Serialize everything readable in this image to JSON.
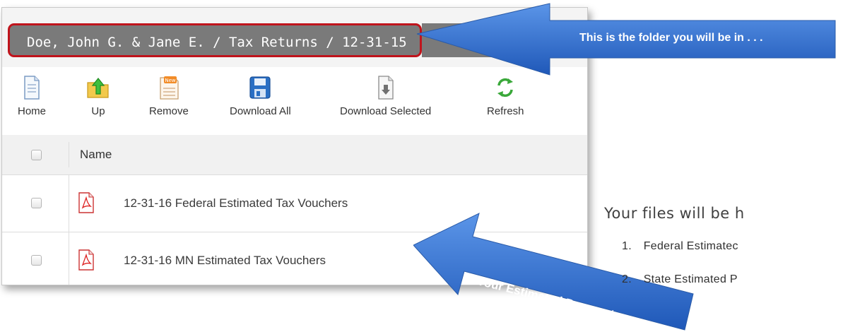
{
  "breadcrumb": "Doe, John G. & Jane E. / Tax Returns / 12-31-15",
  "toolbar": {
    "home": "Home",
    "up": "Up",
    "remove": "Remove",
    "download_all": "Download All",
    "download_selected": "Download Selected",
    "refresh": "Refresh"
  },
  "table": {
    "header_name": "Name",
    "rows": [
      {
        "name": "12-31-16 Federal Estimated Tax Vouchers",
        "icon": "pdf-icon"
      },
      {
        "name": "12-31-16 MN Estimated Tax Vouchers",
        "icon": "pdf-icon"
      }
    ]
  },
  "callouts": {
    "folder": "This is the folder you will be in . . .",
    "payments": "Your Estimated Payments"
  },
  "right_panel": {
    "heading": "Your files will be h",
    "items": [
      {
        "num": "1.",
        "text": "Federal Estimatec"
      },
      {
        "num": "2.",
        "text": "State Estimated P"
      }
    ]
  },
  "colors": {
    "breadcrumb_bg": "#7a7a7a",
    "highlight_border": "#c0141c",
    "arrow_blue": "#2f6fd0"
  }
}
